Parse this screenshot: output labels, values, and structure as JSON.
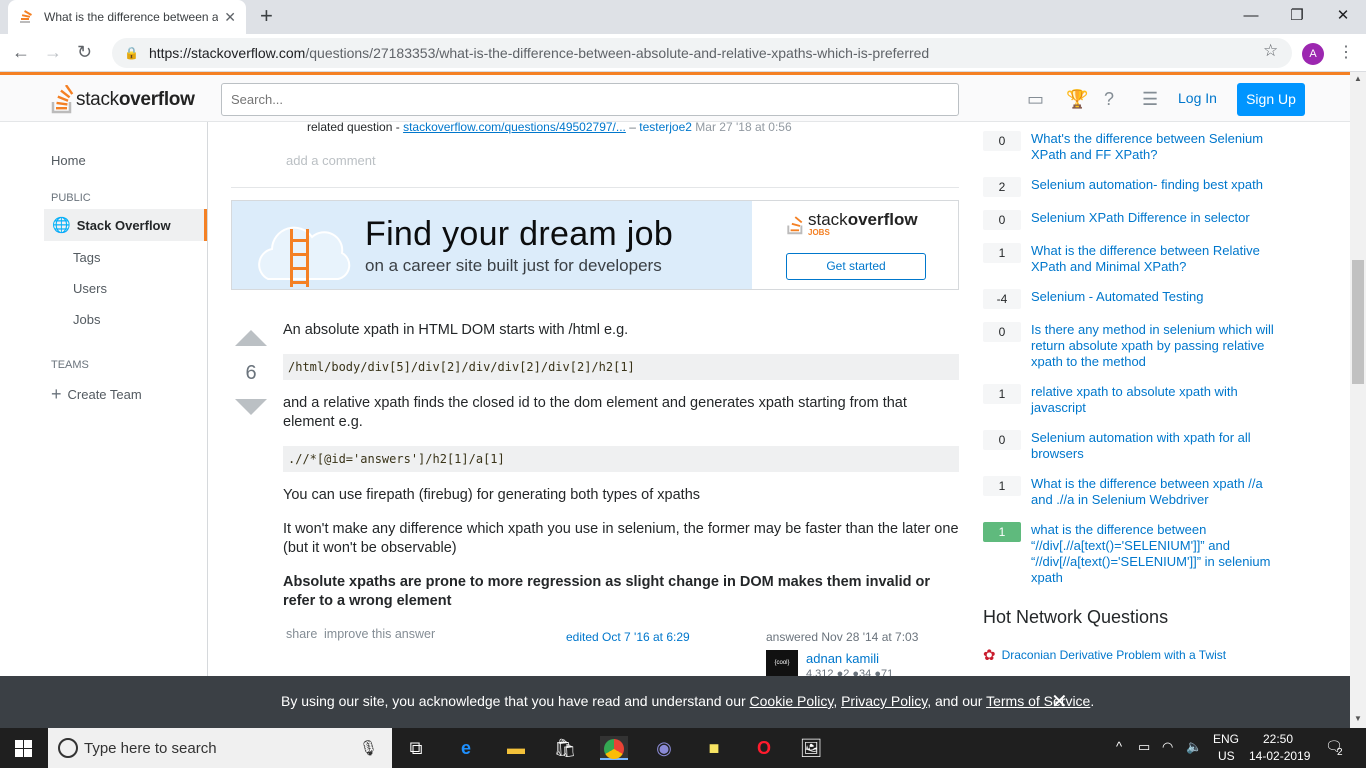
{
  "browser": {
    "tab_title": "What is the difference between a",
    "url_domain": "https://stackoverflow.com",
    "url_path": "/questions/27183353/what-is-the-difference-between-absolute-and-relative-xpaths-which-is-preferred",
    "profile_initial": "A"
  },
  "header": {
    "logo_left": "stack",
    "logo_right": "overflow",
    "search_placeholder": "Search...",
    "login": "Log In",
    "signup": "Sign Up"
  },
  "leftnav": {
    "home": "Home",
    "public": "PUBLIC",
    "stack_overflow": "Stack Overflow",
    "tags": "Tags",
    "users": "Users",
    "jobs": "Jobs",
    "teams": "TEAMS",
    "create_team": "Create Team"
  },
  "question_comment": {
    "prefix": "related question -",
    "link": "stackoverflow.com/questions/49502797/...",
    "dash": "–",
    "user": "testerjoe2",
    "date": "Mar 27 '18 at 0:56",
    "add_comment": "add a comment"
  },
  "ad": {
    "headline": "Find your dream job",
    "subline": "on a career site built just for developers",
    "brand_left": "stack",
    "brand_right": "overflow",
    "brand_sub": "JOBS",
    "cta": "Get started"
  },
  "answer": {
    "votes": "6",
    "p1": "An absolute xpath in HTML DOM starts with /html e.g.",
    "code1": "/html/body/div[5]/div[2]/div/div[2]/div[2]/h2[1]",
    "p2": "and a relative xpath finds the closed id to the dom element and generates xpath starting from that element e.g.",
    "code2": ".//*[@id='answers']/h2[1]/a[1]",
    "p3": "You can use firepath (firebug) for generating both types of xpaths",
    "p4": "It won't make any difference which xpath you use in selenium, the former may be faster than the later one (but it won't be observable)",
    "p5": "Absolute xpaths are prone to more regression as slight change in DOM makes them invalid or refer to a wrong element",
    "share": "share",
    "improve": "improve this answer",
    "edited": "edited Oct 7 '16 at 6:29",
    "answered": "answered Nov 28 '14 at 7:03",
    "user": "adnan kamili",
    "rep": "4,312 ●2 ●34 ●71"
  },
  "related": [
    {
      "score": "0",
      "title": "What's the difference between Selenium XPath and FF XPath?",
      "accepted": false
    },
    {
      "score": "2",
      "title": "Selenium automation- finding best xpath",
      "accepted": false
    },
    {
      "score": "0",
      "title": "Selenium XPath Difference in selector",
      "accepted": false
    },
    {
      "score": "1",
      "title": "What is the difference between Relative XPath and Minimal XPath?",
      "accepted": false
    },
    {
      "score": "-4",
      "title": "Selenium - Automated Testing",
      "accepted": false
    },
    {
      "score": "0",
      "title": "Is there any method in selenium which will return absolute xpath by passing relative xpath to the method",
      "accepted": false
    },
    {
      "score": "1",
      "title": "relative xpath to absolute xpath with javascript",
      "accepted": false
    },
    {
      "score": "0",
      "title": "Selenium automation with xpath for all browsers",
      "accepted": false
    },
    {
      "score": "1",
      "title": "What is the difference between xpath //a and .//a in Selenium Webdriver",
      "accepted": false
    },
    {
      "score": "1",
      "title": "what is the difference between “//div[.//a[text()='SELENIUM']]” and “//div[//a[text()='SELENIUM']]” in selenium xpath",
      "accepted": true
    }
  ],
  "hot_network": {
    "heading": "Hot Network Questions",
    "first": "Draconian Derivative Problem with a Twist"
  },
  "cookie": {
    "t1": "By using our site, you acknowledge that you have read and understand our ",
    "l1": "Cookie Policy",
    "t2": ", ",
    "l2": "Privacy Policy",
    "t3": ", and our ",
    "l3": "Terms of Service",
    "t4": "."
  },
  "taskbar": {
    "search": "Type here to search",
    "lang1": "ENG",
    "lang2": "US",
    "time": "22:50",
    "date": "14-02-2019",
    "notif": "2"
  },
  "colors": {
    "accent": "#f48024",
    "link": "#0077cc",
    "button": "#0095ff",
    "accepted": "#5fba7d"
  }
}
